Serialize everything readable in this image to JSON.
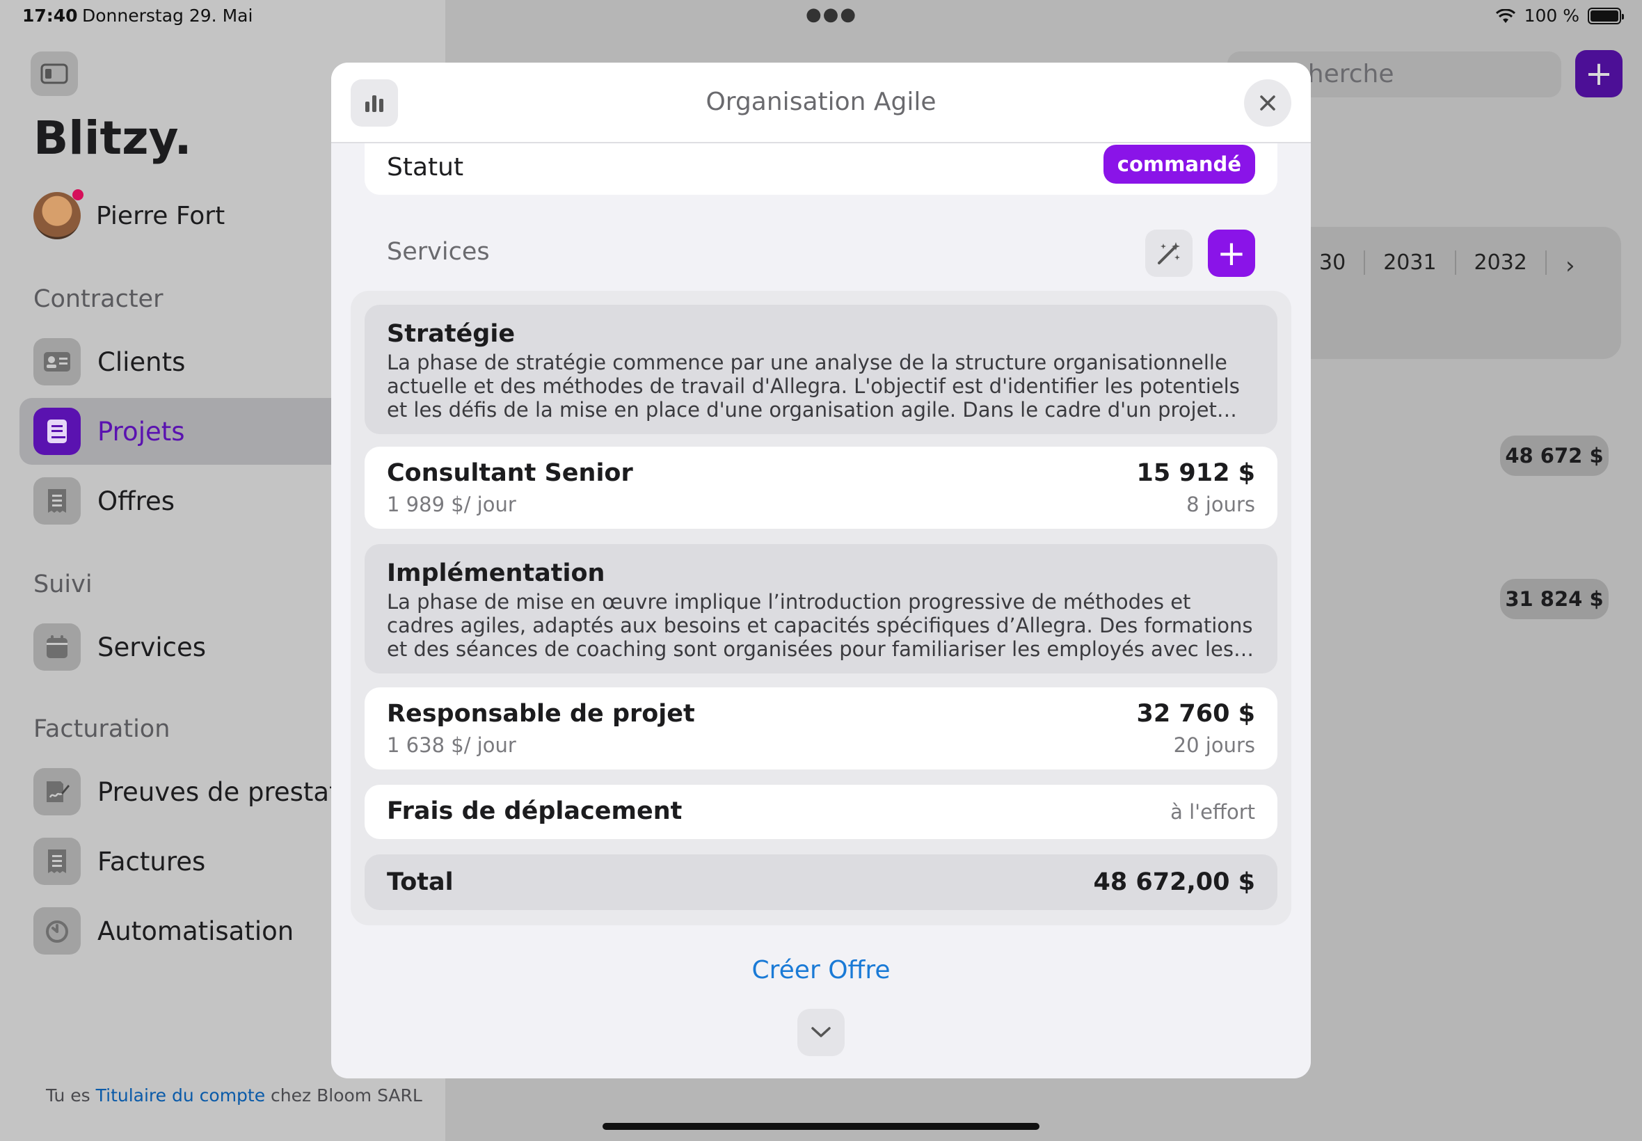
{
  "status_bar": {
    "time": "17:40",
    "date": "Donnerstag 29. Mai",
    "battery": "100 %"
  },
  "sidebar": {
    "app_title": "Blitzy.",
    "user_name": "Pierre Fort",
    "sections": [
      {
        "title": "Contracter",
        "items": [
          {
            "label": "Clients",
            "icon": "id-card-icon"
          },
          {
            "label": "Projets",
            "icon": "book-icon",
            "active": true
          },
          {
            "label": "Offres",
            "icon": "receipt-icon"
          }
        ]
      },
      {
        "title": "Suivi",
        "items": [
          {
            "label": "Services",
            "icon": "calendar-icon"
          }
        ]
      },
      {
        "title": "Facturation",
        "items": [
          {
            "label": "Preuves de prestatio",
            "icon": "signature-icon"
          },
          {
            "label": "Factures",
            "icon": "receipt-icon"
          },
          {
            "label": "Automatisation",
            "icon": "timer-icon"
          }
        ]
      }
    ],
    "footer": {
      "prefix": "Tu es ",
      "link": "Titulaire du compte",
      "suffix": " chez Bloom SARL"
    }
  },
  "background": {
    "search_placeholder": "cherche",
    "years": [
      "30",
      "2031",
      "2032"
    ],
    "amounts": [
      "48 672 $",
      "31 824 $"
    ]
  },
  "modal": {
    "title": "Organisation Agile",
    "statut_label": "Statut",
    "statut_value": "commandé",
    "services_label": "Services",
    "phases": [
      {
        "title": "Stratégie",
        "description": "La phase de stratégie commence par une analyse de la structure organisationnelle actuelle et des méthodes de travail d'Allegra. L'objectif est d'identifier les potentiels et les défis de la mise en place d'une organisation agile. Dans le cadre d'un projet New Work moderne, u…"
      },
      {
        "title": "Implémentation",
        "description": "La phase de mise en œuvre implique l’introduction progressive de méthodes et cadres agiles, adaptés aux besoins et capacités spécifiques d’Allegra. Des formations et des séances de coaching sont organisées pour familiariser les employés avec les nouvelles mé…"
      }
    ],
    "lines": [
      {
        "title": "Consultant Senior",
        "rate": "1 989 $/ jour",
        "amount": "15 912 $",
        "duration": "8 jours"
      },
      {
        "title": "Responsable de projet",
        "rate": "1 638 $/ jour",
        "amount": "32 760 $",
        "duration": "20 jours"
      }
    ],
    "travel": {
      "title": "Frais de déplacement",
      "value": "à l'effort"
    },
    "total": {
      "label": "Total",
      "value": "48 672,00 $"
    },
    "create_label": "Créer Offre"
  }
}
